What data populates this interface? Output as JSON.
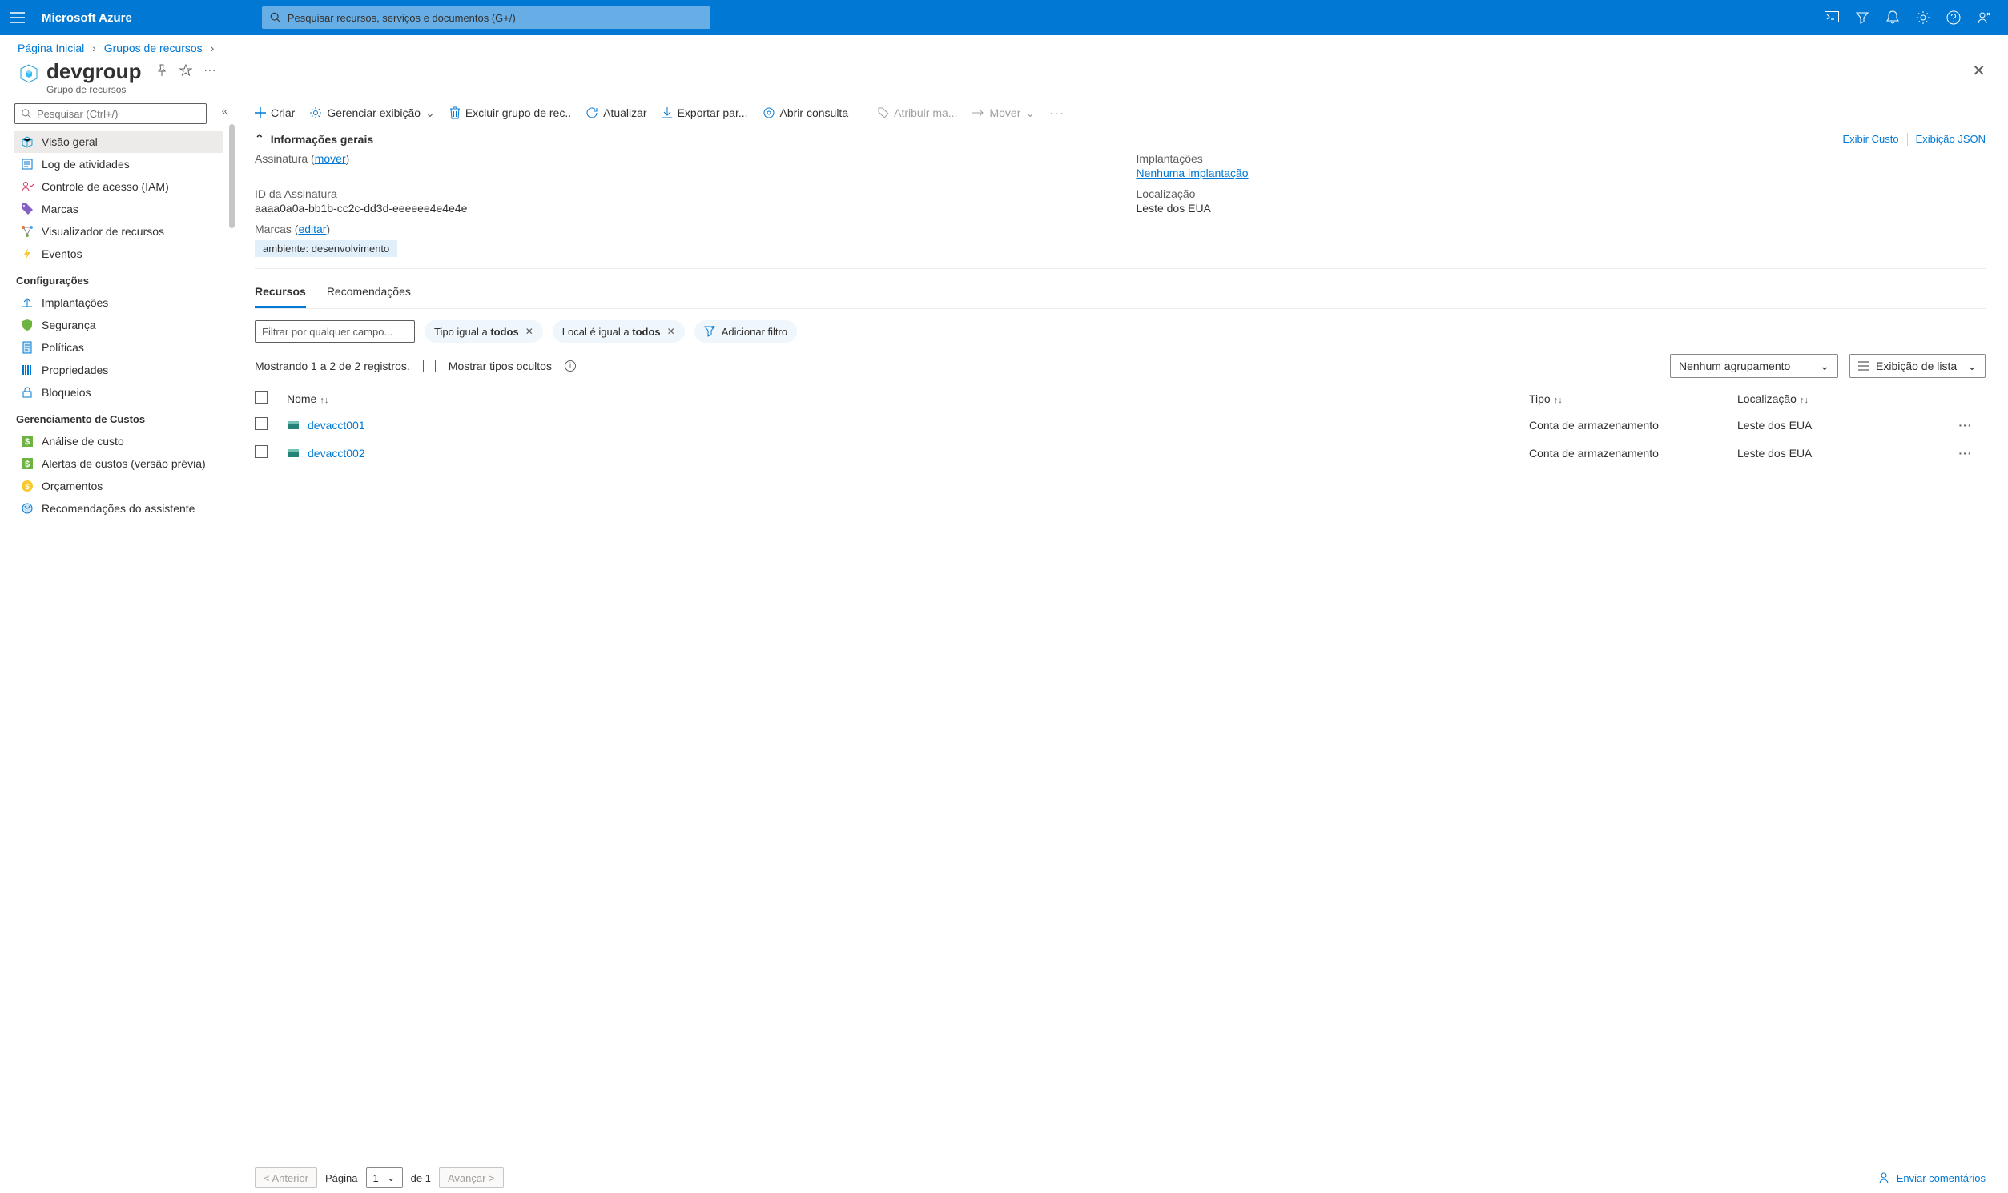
{
  "brand": "Microsoft Azure",
  "search_placeholder": "Pesquisar recursos, serviços e documentos (G+/)",
  "breadcrumb": {
    "home": "Página Inicial",
    "groups": "Grupos de recursos"
  },
  "title": "devgroup",
  "subtitle": "Grupo de recursos",
  "side_search_placeholder": "Pesquisar (Ctrl+/)",
  "sidebar": {
    "items": [
      {
        "label": "Visão geral"
      },
      {
        "label": "Log de atividades"
      },
      {
        "label": "Controle de acesso (IAM)"
      },
      {
        "label": "Marcas"
      },
      {
        "label": "Visualizador de recursos"
      },
      {
        "label": "Eventos"
      }
    ],
    "section_settings": "Configurações",
    "settings": [
      {
        "label": "Implantações"
      },
      {
        "label": "Segurança"
      },
      {
        "label": "Políticas"
      },
      {
        "label": "Propriedades"
      },
      {
        "label": "Bloqueios"
      }
    ],
    "section_cost": "Gerenciamento de Custos",
    "cost": [
      {
        "label": "Análise de custo"
      },
      {
        "label": "Alertas de custos (versão prévia)"
      },
      {
        "label": "Orçamentos"
      },
      {
        "label": "Recomendações do assistente"
      }
    ]
  },
  "toolbar": {
    "create": "Criar",
    "manage_view": "Gerenciar exibição",
    "delete": "Excluir grupo de rec..",
    "refresh": "Atualizar",
    "export": "Exportar par...",
    "open_query": "Abrir consulta",
    "assign": "Atribuir ma...",
    "move": "Mover"
  },
  "essentials": {
    "header": "Informações gerais",
    "view_cost": "Exibir Custo",
    "json_view": "Exibição JSON",
    "sub_label_prefix": "Assinatura (",
    "sub_move": "mover",
    "sub_label_suffix": ")",
    "subid_label": "ID da Assinatura",
    "subid": "aaaa0a0a-bb1b-cc2c-dd3d-eeeeee4e4e4e",
    "tags_label_prefix": "Marcas (",
    "tags_edit": "editar",
    "tags_label_suffix": ")",
    "tag_chip": "ambiente: desenvolvimento",
    "deploy_label": "Implantações",
    "deploy_value": "Nenhuma implantação",
    "loc_label": "Localização",
    "loc_value": "Leste dos EUA"
  },
  "tabs": {
    "resources": "Recursos",
    "recommendations": "Recomendações"
  },
  "filters": {
    "field_placeholder": "Filtrar por qualquer campo...",
    "type_prefix": "Tipo igual a ",
    "type_value": "todos",
    "loc_prefix": "Local é igual a ",
    "loc_value": "todos",
    "add": "Adicionar filtro"
  },
  "records": {
    "showing": "Mostrando 1 a 2 de 2 registros.",
    "show_hidden": "Mostrar tipos ocultos",
    "no_grouping": "Nenhum agrupamento",
    "list_view": "Exibição de lista"
  },
  "table": {
    "h_name": "Nome",
    "h_type": "Tipo",
    "h_loc": "Localização",
    "rows": [
      {
        "name": "devacct001",
        "type": "Conta de armazenamento",
        "loc": "Leste dos EUA"
      },
      {
        "name": "devacct002",
        "type": "Conta de armazenamento",
        "loc": "Leste dos EUA"
      }
    ]
  },
  "pager": {
    "prev": "< Anterior",
    "page_label": "Página",
    "page": "1",
    "of": "de 1",
    "next": "Avançar >",
    "feedback": "Enviar comentários"
  }
}
